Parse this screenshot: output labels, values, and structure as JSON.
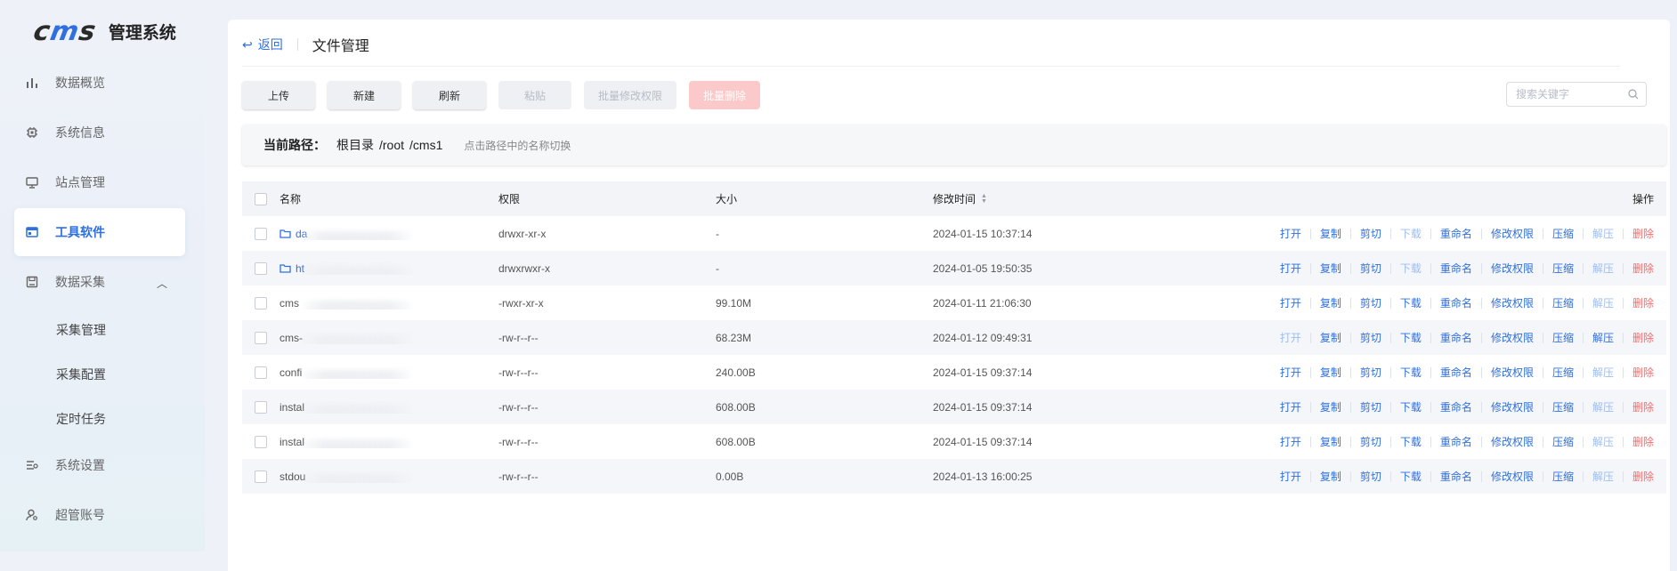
{
  "brand": {
    "logo_mark_left": "c",
    "logo_mark_mid": "m",
    "logo_mark_right": "s",
    "title": "管理系统"
  },
  "sidebar": {
    "items": [
      {
        "label": "数据概览",
        "icon": "bar-chart-icon"
      },
      {
        "label": "系统信息",
        "icon": "cpu-icon"
      },
      {
        "label": "站点管理",
        "icon": "monitor-icon"
      },
      {
        "label": "工具软件",
        "icon": "window-icon",
        "active": true
      },
      {
        "label": "数据采集",
        "icon": "save-icon",
        "expanded": true
      },
      {
        "label": "系统设置",
        "icon": "settings-list-icon"
      },
      {
        "label": "超管账号",
        "icon": "user-gear-icon"
      }
    ],
    "submenu": [
      {
        "label": "采集管理"
      },
      {
        "label": "采集配置"
      },
      {
        "label": "定时任务"
      }
    ]
  },
  "header": {
    "back_label": "返回",
    "title": "文件管理"
  },
  "toolbar": {
    "upload": "上传",
    "create": "新建",
    "refresh": "刷新",
    "paste": "粘贴",
    "batch_perm": "批量修改权限",
    "batch_delete": "批量删除"
  },
  "search": {
    "placeholder": "搜索关键字"
  },
  "path": {
    "label": "当前路径：",
    "segments": [
      "根目录",
      "/root",
      "/cms1"
    ],
    "hint": "点击路径中的名称切换"
  },
  "table": {
    "headers": {
      "name": "名称",
      "perm": "权限",
      "size": "大小",
      "time": "修改时间",
      "ops": "操作"
    },
    "ops": [
      "打开",
      "复制",
      "剪切",
      "下载",
      "重命名",
      "修改权限",
      "压缩",
      "解压",
      "删除"
    ],
    "rows": [
      {
        "name": "da",
        "folder": true,
        "perm": "drwxr-xr-x",
        "size": "-",
        "time": "2024-01-15 10:37:14",
        "disabled_ops": [
          3,
          7
        ]
      },
      {
        "name": "ht",
        "folder": true,
        "perm": "drwxrwxr-x",
        "size": "-",
        "time": "2024-01-05 19:50:35",
        "disabled_ops": [
          3,
          7
        ]
      },
      {
        "name": "cms",
        "folder": false,
        "perm": "-rwxr-xr-x",
        "size": "99.10M",
        "time": "2024-01-11 21:06:30",
        "disabled_ops": [
          7
        ]
      },
      {
        "name": "cms-",
        "folder": false,
        "perm": "-rw-r--r--",
        "size": "68.23M",
        "time": "2024-01-12 09:49:31",
        "disabled_ops": [
          0
        ]
      },
      {
        "name": "confi",
        "folder": false,
        "perm": "-rw-r--r--",
        "size": "240.00B",
        "time": "2024-01-15 09:37:14",
        "disabled_ops": [
          7
        ]
      },
      {
        "name": "instal",
        "folder": false,
        "perm": "-rw-r--r--",
        "size": "608.00B",
        "time": "2024-01-15 09:37:14",
        "disabled_ops": [
          7
        ]
      },
      {
        "name": "instal",
        "folder": false,
        "perm": "-rw-r--r--",
        "size": "608.00B",
        "time": "2024-01-15 09:37:14",
        "disabled_ops": [
          7
        ]
      },
      {
        "name": "stdou",
        "folder": false,
        "perm": "-rw-r--r--",
        "size": "0.00B",
        "time": "2024-01-13 16:00:25",
        "disabled_ops": [
          7
        ]
      }
    ]
  },
  "colors": {
    "accent": "#2f6fe0",
    "danger": "#f26b6b",
    "disabled": "#9dbdf0"
  }
}
